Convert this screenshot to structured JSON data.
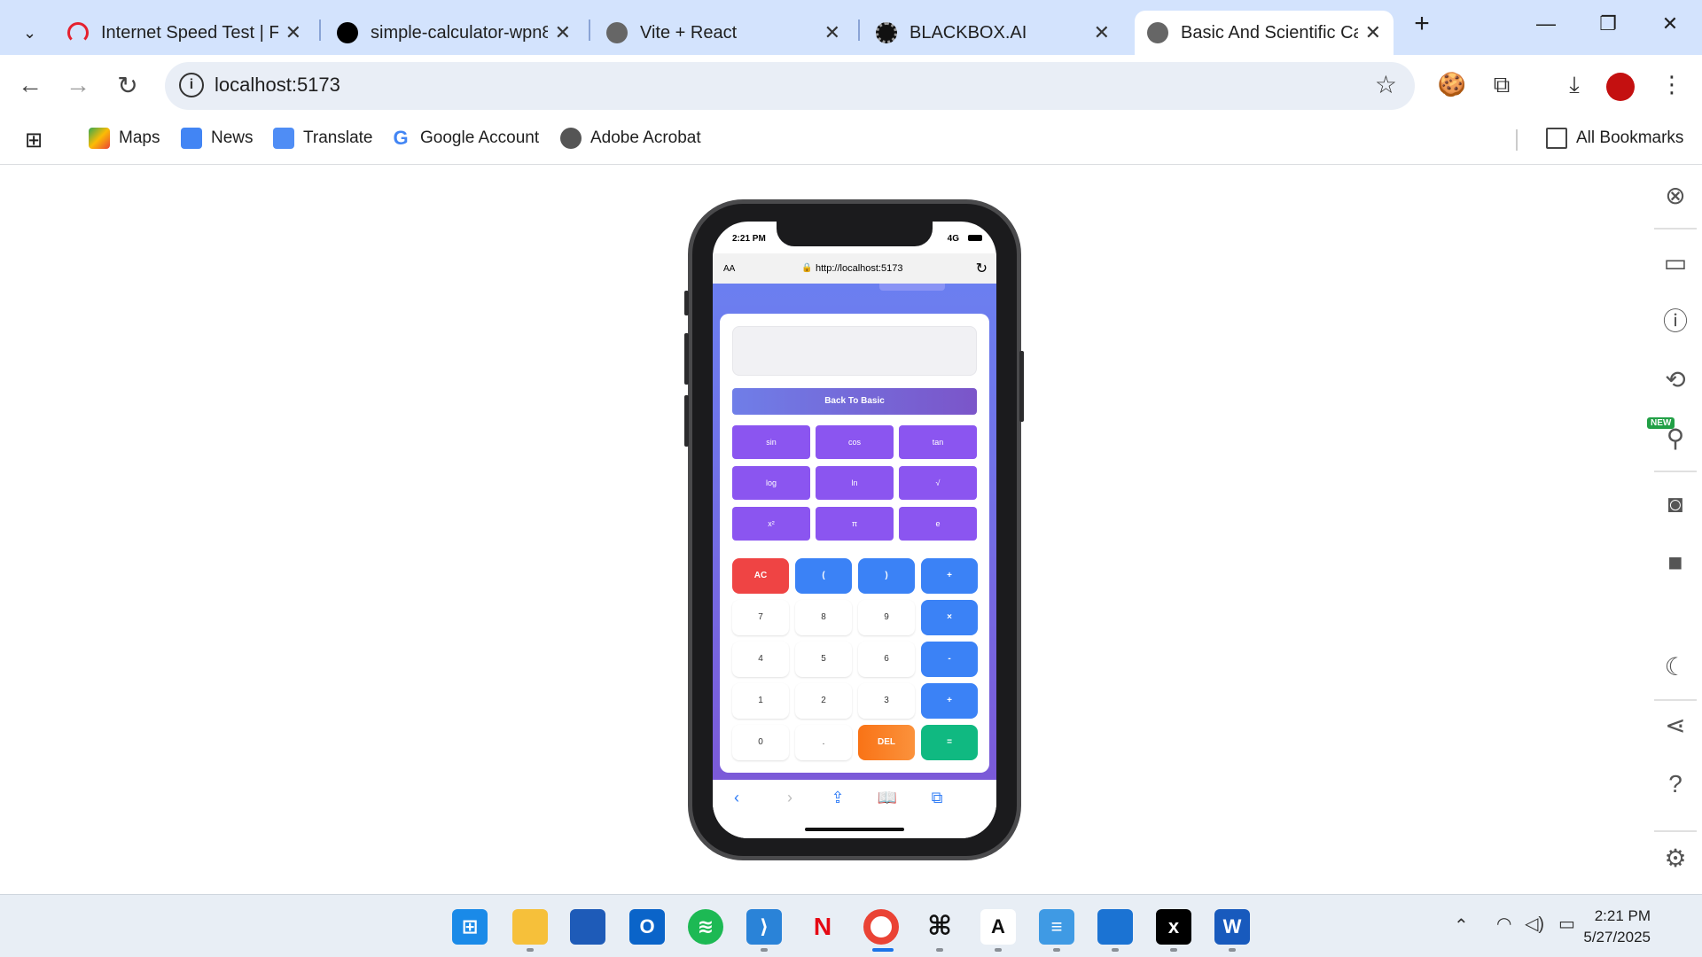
{
  "browser": {
    "tabs": [
      {
        "title": "Internet Speed Test | Fast.com"
      },
      {
        "title": "simple-calculator-wpn8"
      },
      {
        "title": "Vite + React"
      },
      {
        "title": "BLACKBOX.AI"
      },
      {
        "title": "Basic And Scientific Calculator",
        "active": true
      }
    ],
    "new_tab": "+",
    "close": "✕",
    "url": "localhost:5173",
    "bookmarks": [
      {
        "label": "Maps"
      },
      {
        "label": "News"
      },
      {
        "label": "Translate"
      },
      {
        "label": "Google Account"
      },
      {
        "label": "Adobe Acrobat"
      }
    ],
    "all_bookmarks": "All Bookmarks"
  },
  "phone": {
    "time": "2:21 PM",
    "network": "4G",
    "text_size": "AA",
    "url": "http://localhost:5173"
  },
  "calculator": {
    "back_label": "Back To Basic",
    "scientific": [
      "sin",
      "cos",
      "tan",
      "log",
      "ln",
      "√",
      "x²",
      "π",
      "e"
    ],
    "keys": [
      [
        "AC",
        "(",
        ")",
        "+"
      ],
      [
        "7",
        "8",
        "9",
        "×"
      ],
      [
        "4",
        "5",
        "6",
        "-"
      ],
      [
        "1",
        "2",
        "3",
        "+"
      ],
      [
        "0",
        ".",
        "DEL",
        "="
      ]
    ]
  },
  "sidebar": {
    "new_badge": "NEW"
  },
  "taskbar": {
    "time": "2:21 PM",
    "date": "5/27/2025"
  }
}
